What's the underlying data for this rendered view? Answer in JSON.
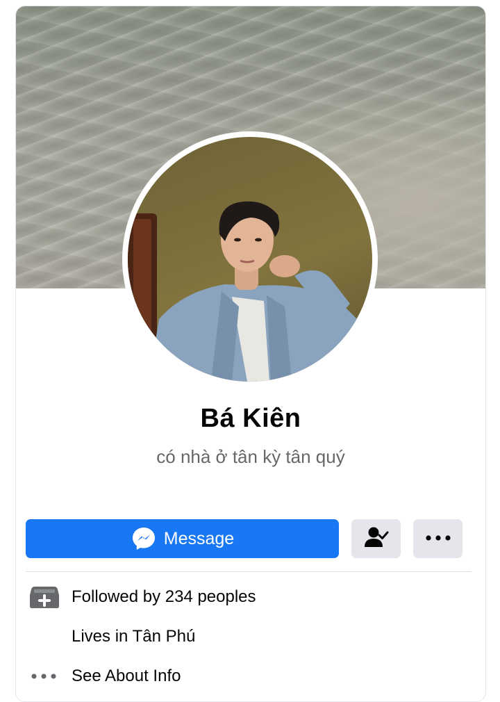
{
  "profile": {
    "name": "Bá Kiên",
    "bio": "có nhà ở tân kỳ tân quý"
  },
  "actions": {
    "message_label": "Message",
    "friend_icon": "person-check-icon",
    "more_icon": "more-horizontal-icon"
  },
  "details": {
    "followers": {
      "icon": "follower-inbox-icon",
      "label": "Followed by 234 peoples"
    },
    "lives": {
      "label": "Lives in Tân Phú"
    },
    "about": {
      "icon": "more-dots-icon",
      "label": "See About Info"
    }
  },
  "colors": {
    "primary_button": "#1877f2",
    "secondary_button": "#e4e6eb",
    "text_primary": "#050505",
    "text_secondary": "#65676b"
  }
}
